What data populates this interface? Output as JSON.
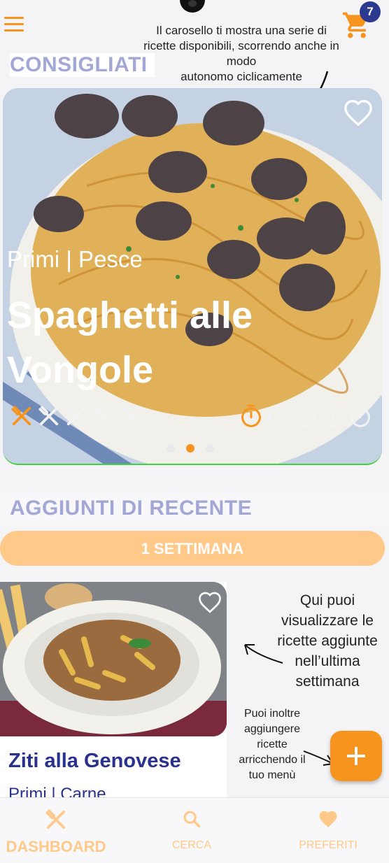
{
  "header": {
    "cart_count": "7",
    "carousel_note": "Il carosello ti mostra una serie di ricette disponibili, scorrendo anche in modo autonomo ciclicamente",
    "carousel_note_lines": [
      "Il carosello ti mostra una serie di",
      "ricette disponibili, scorrendo anche in",
      "modo",
      "autonomo ciclicamente"
    ]
  },
  "sections": {
    "recommended_title": "CONSIGLIATI",
    "recent_title": "AGGIUNTI DI RECENTE"
  },
  "carousel": {
    "category": "Primi | Pesce",
    "title": "Spaghetti alle Vongole",
    "difficulty_level": 1,
    "difficulty_max": 5,
    "time_level": 1,
    "time_max": 5,
    "active_slide": 2,
    "slide_count": 3,
    "favorite": false
  },
  "filter": {
    "week_label": "1 SETTIMANA"
  },
  "recent_card": {
    "title": "Ziti alla Genovese",
    "category": "Primi | Carne",
    "favorite": false
  },
  "annotations": {
    "recent_note_lines": [
      "Qui puoi",
      "visualizzare le",
      "ricette aggiunte",
      "nell’ultima",
      "settimana"
    ],
    "add_note_lines": [
      "Puoi inoltre",
      "aggiungere",
      "ricette",
      "arricchendo il",
      "tuo menù"
    ]
  },
  "bottom_nav": {
    "dashboard": "DASHBOARD",
    "search": "CERCA",
    "favorites": "PREFERITI"
  },
  "colors": {
    "accent": "#f7941d",
    "accent_light": "#ffc98a",
    "section_title": "#a3a7d6",
    "card_title": "#28328c",
    "badge": "#2b3a8f"
  },
  "icons": [
    "menu-icon",
    "cart-icon",
    "heart-icon",
    "cutlery-icon",
    "timer-icon",
    "plus-icon",
    "search-icon"
  ]
}
